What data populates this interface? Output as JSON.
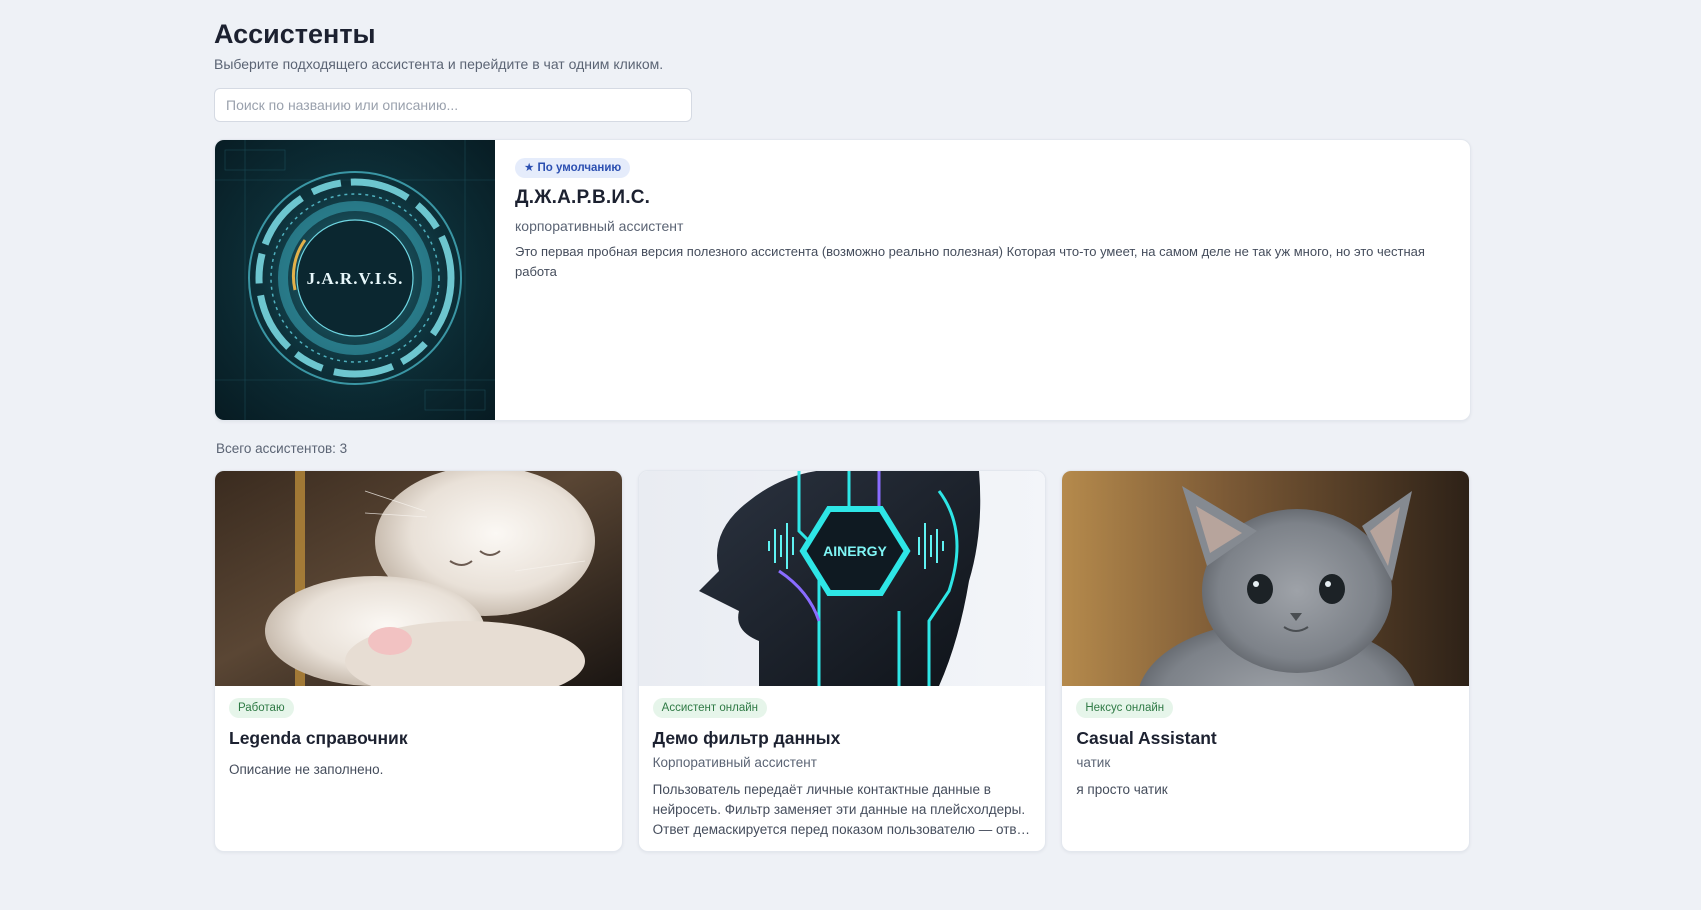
{
  "header": {
    "title": "Ассистенты",
    "subtitle": "Выберите подходящего ассистента и перейдите в чат одним кликом."
  },
  "search": {
    "placeholder": "Поиск по названию или описанию...",
    "value": ""
  },
  "featured": {
    "badge": "★ По умолчанию",
    "name": "Д.Ж.А.Р.В.И.С.",
    "role": "корпоративный ассистент",
    "description": "Это первая пробная версия полезного ассистента (возможно реально полезная) Которая что-то умеет, на самом деле не так уж много, но это честная работа",
    "image_logo_text": "J.A.R.V.I.S."
  },
  "total_label": "Всего ассистентов: 3",
  "assistants": [
    {
      "badge": "Работаю",
      "name": "Legenda справочник",
      "role": "",
      "description": "Описание не заполнено."
    },
    {
      "badge": "Ассистент онлайн",
      "name": "Демо фильтр данных",
      "role": "Корпоративный ассистент",
      "description": "Пользователь передаёт личные контактные данные в нейросеть. Фильтр заменяет эти данные на плейсхолдеры. Ответ демаскируется перед показом пользователю — ответ остаётся полным.",
      "image_logo_text": "AINERGY"
    },
    {
      "badge": "Нексус онлайн",
      "name": "Casual Assistant",
      "role": "чатик",
      "description": "я просто чатик"
    }
  ],
  "colors": {
    "background": "#eef1f6",
    "default_badge_bg": "#e5ecfb",
    "default_badge_text": "#2b4fb1",
    "status_badge_bg": "#e6f5ea",
    "status_badge_text": "#2f7a45"
  }
}
